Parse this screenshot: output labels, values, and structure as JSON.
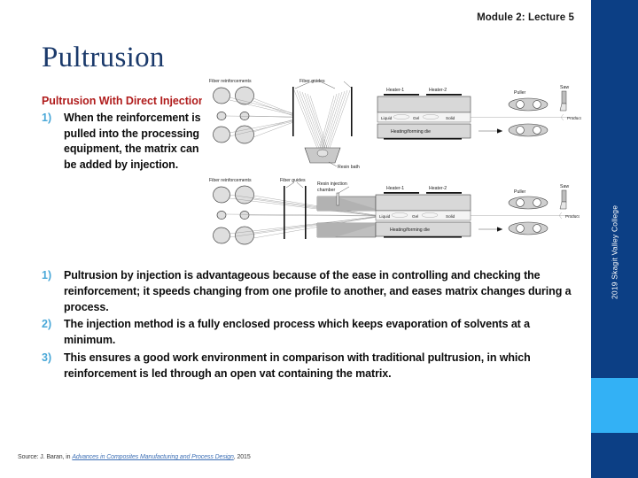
{
  "header": {
    "module_label": "Module 2: Lecture 5"
  },
  "title": "Pultrusion",
  "brand": {
    "vertical_text": "2019 Skagit Valley College",
    "bar_color": "#0c3f85",
    "accent_color": "#33b1f5"
  },
  "content": {
    "subheading": "Pultrusion With Direct Injection",
    "subheading_color": "#b01c1c",
    "number_color": "#4aa8d8",
    "first_bullet": {
      "number": "1)",
      "text": "When the reinforcement is pulled into the processing equipment, the matrix can be added by injection."
    },
    "bullets": [
      {
        "number": "1)",
        "text": "Pultrusion by injection is advantageous because of the ease in controlling and checking the reinforcement; it speeds changing from one profile to another, and eases matrix changes during a process."
      },
      {
        "number": "2)",
        "text": "The injection method is a fully enclosed process which keeps evaporation of solvents at a minimum."
      },
      {
        "number": "3)",
        "text": "This ensures a good work environment in comparison with traditional pultrusion, in which reinforcement is led through an open vat containing the matrix."
      }
    ]
  },
  "figures": {
    "top": {
      "caption_labels": {
        "fiber_reinforcements": "Fiber reinforcements",
        "fiber_guides": "Fiber guides",
        "resin_bath": "Resin bath",
        "heater1": "Heater-1",
        "heater2": "Heater-2",
        "die": "Heating/forming die",
        "puller": "Puller",
        "saw": "Saw",
        "product": "Product",
        "liquid": "Liquid",
        "gel": "Gel",
        "solid": "Solid"
      }
    },
    "bottom": {
      "caption_labels": {
        "fiber_reinforcements": "Fiber reinforcements",
        "fiber_guides": "Fiber guides",
        "resin_injection_chamber": "Resin injection chamber",
        "heater1": "Heater-1",
        "heater2": "Heater-2",
        "die": "Heating/forming die",
        "puller": "Puller",
        "saw": "Saw",
        "product": "Product",
        "liquid": "Liquid",
        "gel": "Gel",
        "solid": "Solid"
      }
    }
  },
  "source": {
    "prefix": "Source: J. Baran, in ",
    "link_text": "Advances in Composites Manufacturing and Process Design",
    "suffix": ", 2015"
  }
}
